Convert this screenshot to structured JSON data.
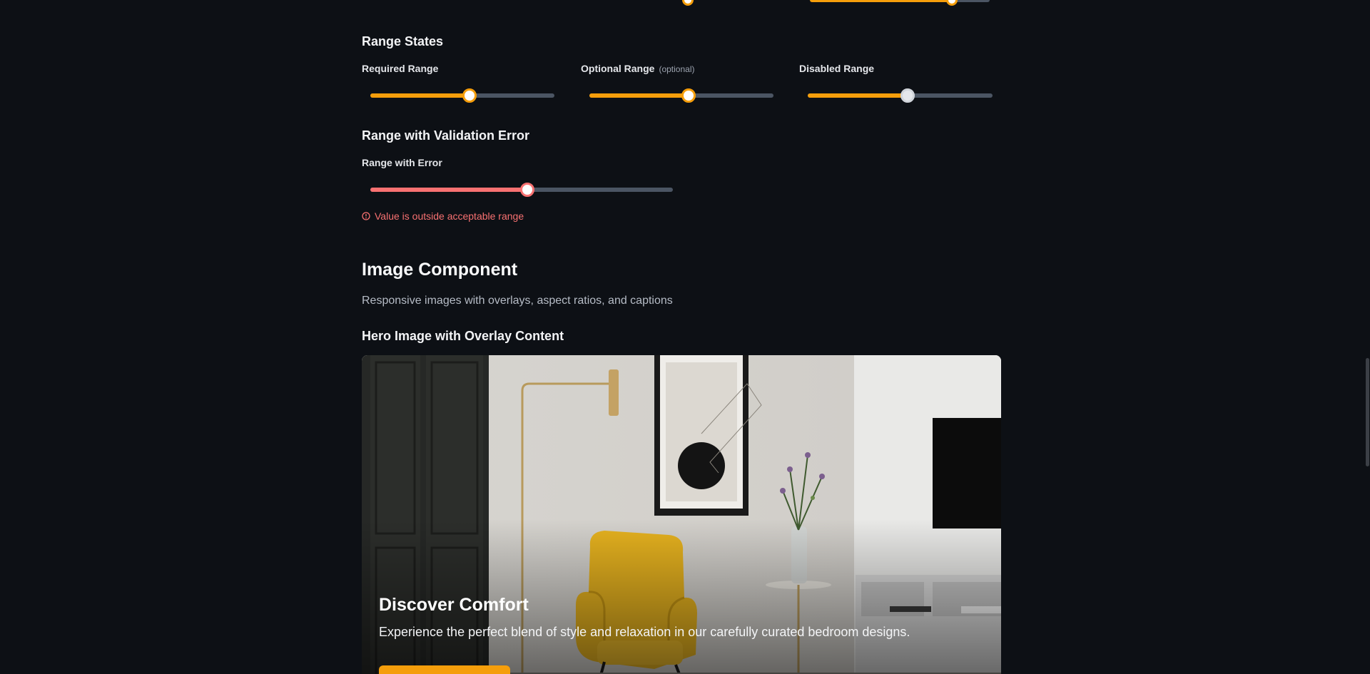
{
  "range_states": {
    "heading": "Range States",
    "required": {
      "label": "Required Range",
      "value": 54
    },
    "optional": {
      "label": "Optional Range",
      "tag": "(optional)",
      "value": 54
    },
    "disabled": {
      "label": "Disabled Range",
      "value": 54
    }
  },
  "validation": {
    "heading": "Range with Validation Error",
    "label": "Range with Error",
    "value": 52,
    "error": "Value is outside acceptable range"
  },
  "image_component": {
    "title": "Image Component",
    "description": "Responsive images with overlays, aspect ratios, and captions",
    "hero_heading": "Hero Image with Overlay Content",
    "overlay_title": "Discover Comfort",
    "overlay_text": "Experience the perfect blend of style and relaxation in our carefully curated bedroom designs."
  },
  "colors": {
    "accent": "#f59e0b",
    "error": "#f87171",
    "background": "#0d1015",
    "track": "#4b5563"
  }
}
